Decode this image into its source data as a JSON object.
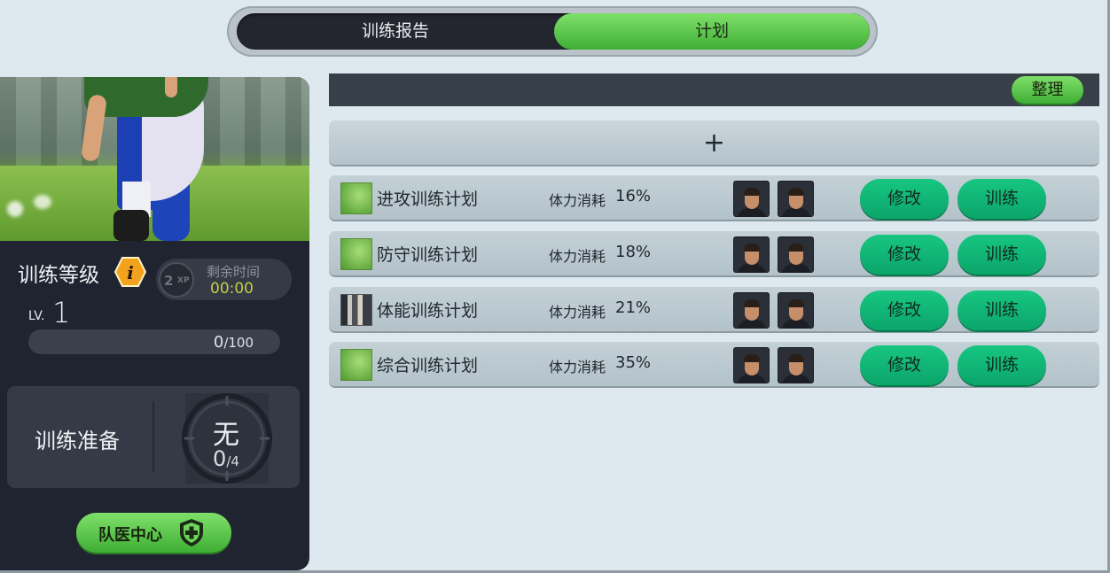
{
  "tabs": {
    "report_label": "训练报告",
    "plan_label": "计划",
    "active": "plan"
  },
  "left_panel": {
    "level_title": "训练等级",
    "xp_badge": {
      "text": "2",
      "sub": "XP"
    },
    "remaining": {
      "label": "剩余时间",
      "time": "00:00"
    },
    "level": {
      "prefix": "LV.",
      "value": "1"
    },
    "xp_progress": {
      "current": "0",
      "max": "/100",
      "fraction": 0
    },
    "prep": {
      "label": "训练准备",
      "slot_text": "无",
      "count": "0",
      "count_max": "/4"
    },
    "doctor_button": {
      "label": "队医中心"
    }
  },
  "toolbar": {
    "sort_label": "整理"
  },
  "add_plan": {
    "label": "+"
  },
  "plans": [
    {
      "name": "进攻训练计划",
      "cost_label": "体力消耗",
      "cost_value": "16%",
      "thumb": "grass-field",
      "edit_label": "修改",
      "train_label": "训练"
    },
    {
      "name": "防守训练计划",
      "cost_label": "体力消耗",
      "cost_value": "18%",
      "thumb": "grass-field",
      "edit_label": "修改",
      "train_label": "训练"
    },
    {
      "name": "体能训练计划",
      "cost_label": "体力消耗",
      "cost_value": "21%",
      "thumb": "gym",
      "edit_label": "修改",
      "train_label": "训练"
    },
    {
      "name": "综合训练计划",
      "cost_label": "体力消耗",
      "cost_value": "35%",
      "thumb": "grass-field",
      "edit_label": "修改",
      "train_label": "训练"
    }
  ],
  "colors": {
    "accent_green": "#4fc43d",
    "action_green": "#10b977",
    "panel_dark": "#1f2430",
    "timer_yellow": "#c6cc46"
  }
}
